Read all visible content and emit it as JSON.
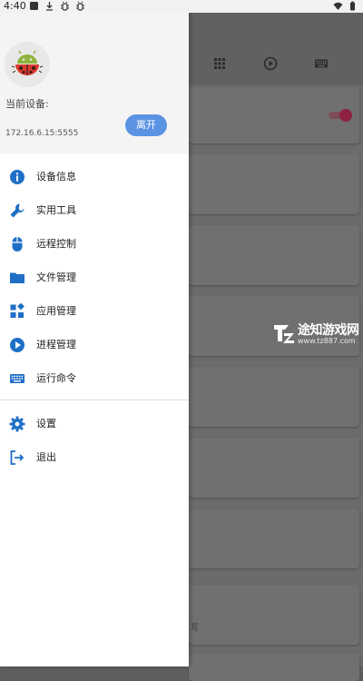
{
  "status_bar": {
    "time": "4:40"
  },
  "drawer": {
    "device_label": "当前设备:",
    "device_ip": "172.16.6.15:5555",
    "leave_button": "离开",
    "menu_items": [
      {
        "label": "设备信息",
        "icon": "info-icon"
      },
      {
        "label": "实用工具",
        "icon": "wrench-icon"
      },
      {
        "label": "远程控制",
        "icon": "mouse-icon"
      },
      {
        "label": "文件管理",
        "icon": "folder-icon"
      },
      {
        "label": "应用管理",
        "icon": "widgets-icon"
      },
      {
        "label": "进程管理",
        "icon": "play-circle-icon"
      },
      {
        "label": "运行命令",
        "icon": "keyboard-icon"
      }
    ],
    "secondary_items": [
      {
        "label": "设置",
        "icon": "gear-icon"
      },
      {
        "label": "退出",
        "icon": "exit-icon"
      }
    ],
    "icon_color": "#1f6fc7"
  },
  "background_app": {
    "partial_text": "写"
  },
  "watermark": {
    "main": "途知游戏网",
    "sub": "www.tz887.com"
  }
}
